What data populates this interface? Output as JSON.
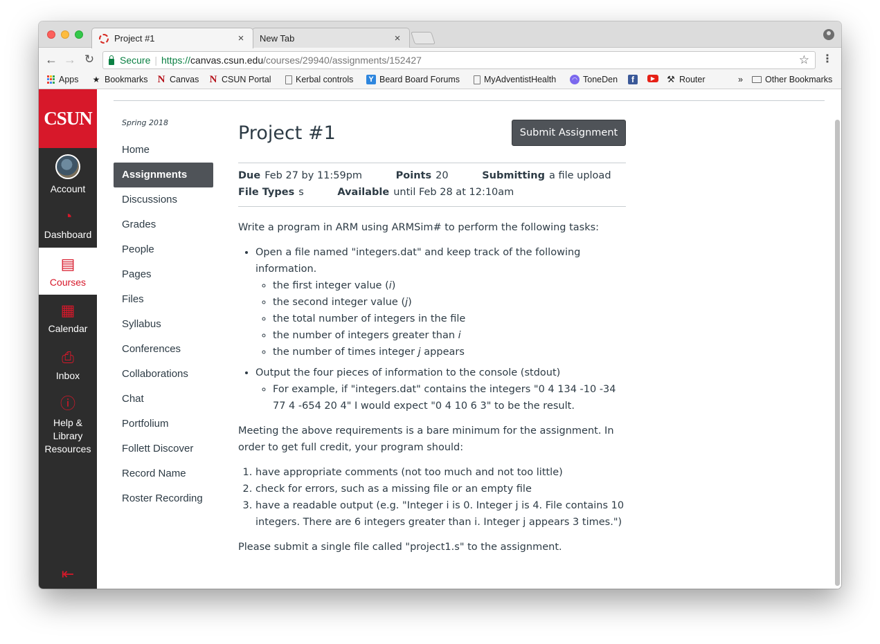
{
  "browser": {
    "tabs": [
      {
        "label": "Project #1",
        "close": "×"
      },
      {
        "label": "New Tab",
        "close": "×"
      }
    ],
    "omnibox": {
      "secure_label": "Secure",
      "url_scheme": "https://",
      "url_host": "canvas.csun.edu",
      "url_path": "/courses/29940/assignments/152427"
    },
    "bookmarks": [
      {
        "label": "Apps"
      },
      {
        "label": "Bookmarks"
      },
      {
        "label": "Canvas"
      },
      {
        "label": "CSUN Portal"
      },
      {
        "label": "Kerbal controls"
      },
      {
        "label": "Beard Board Forums"
      },
      {
        "label": "MyAdventistHealth"
      },
      {
        "label": "ToneDen"
      },
      {
        "label": ""
      },
      {
        "label": ""
      },
      {
        "label": "Router"
      }
    ],
    "overflow_label": "»",
    "other_bookmarks": "Other Bookmarks"
  },
  "global_nav": {
    "logo": "CSUN",
    "items": [
      {
        "label": "Account"
      },
      {
        "label": "Dashboard"
      },
      {
        "label": "Courses"
      },
      {
        "label": "Calendar"
      },
      {
        "label": "Inbox"
      },
      {
        "label": "Help & Library Resources"
      }
    ],
    "collapse_icon": "collapse-nav-icon"
  },
  "course": {
    "term": "Spring 2018",
    "nav": [
      "Home",
      "Assignments",
      "Discussions",
      "Grades",
      "People",
      "Pages",
      "Files",
      "Syllabus",
      "Conferences",
      "Collaborations",
      "Chat",
      "Portfolium",
      "Follett Discover",
      "Record Name",
      "Roster Recording"
    ],
    "active_nav": "Assignments"
  },
  "assignment": {
    "title": "Project #1",
    "submit_label": "Submit Assignment",
    "details": {
      "due_label": "Due",
      "due_value": "Feb 27 by 11:59pm",
      "points_label": "Points",
      "points_value": "20",
      "submitting_label": "Submitting",
      "submitting_value": "a file upload",
      "filetypes_label": "File Types",
      "filetypes_value": "s",
      "available_label": "Available",
      "available_value": "until Feb 28 at 12:10am"
    },
    "intro": "Write a program in ARM using ARMSim# to perform the following tasks:",
    "task1": "Open a file named \"integers.dat\" and keep track of the following information.",
    "task1_items": [
      {
        "pre": "the first integer value (",
        "em": "i",
        "post": ")"
      },
      {
        "pre": "the second integer value (",
        "em": "j",
        "post": ")"
      },
      {
        "pre": "the total number of integers in the file",
        "em": "",
        "post": ""
      },
      {
        "pre": "the number of integers greater than ",
        "em": "i",
        "post": ""
      },
      {
        "pre": "the number of times integer ",
        "em": "j",
        "post": " appears"
      }
    ],
    "task2": "Output the four pieces of information to the console (stdout)",
    "task2_items": [
      "For example, if \"integers.dat\" contains the integers \"0 4 134 -10 -34 77 4 -654 20 4\" I would expect \"0 4 10 6 3\" to be the result."
    ],
    "requirements_intro": "Meeting the above requirements is a bare minimum for the assignment. In order to get full credit, your program should:",
    "requirements": [
      "have appropriate comments (not too much and not too little)",
      "check for errors, such as a missing file or an empty file",
      "have a readable output (e.g. \"Integer i is 0. Integer j is 4. File contains 10 integers. There are 6 integers greater than i. Integer j appears 3 times.\")"
    ],
    "closing": "Please submit a single file called \"project1.s\" to the assignment."
  }
}
